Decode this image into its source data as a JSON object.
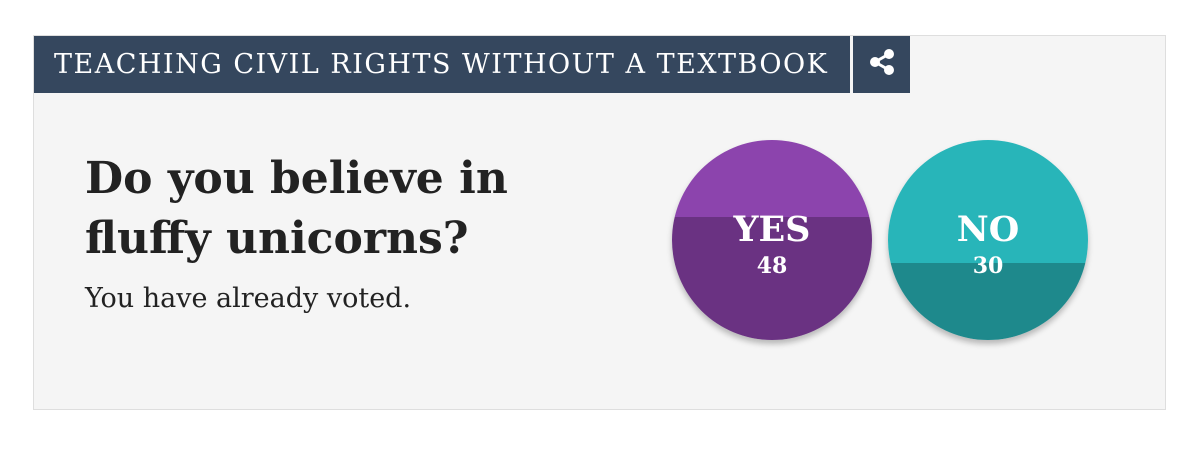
{
  "poll": {
    "title": "TEACHING CIVIL RIGHTS WITHOUT A TEXTBOOK",
    "share_icon": "share-icon",
    "question": "Do you believe in fluffy unicorns?",
    "status": "You have already voted.",
    "options": [
      {
        "label": "YES",
        "count": "48",
        "result_fraction": 0.615,
        "color_light": "#8c44ad",
        "color_dark": "#6a3282"
      },
      {
        "label": "NO",
        "count": "30",
        "result_fraction": 0.385,
        "color_light": "#28b5b9",
        "color_dark": "#1e898c"
      }
    ]
  },
  "colors": {
    "header_bg": "#35475e",
    "card_bg": "#f5f5f5",
    "text": "#222222"
  }
}
